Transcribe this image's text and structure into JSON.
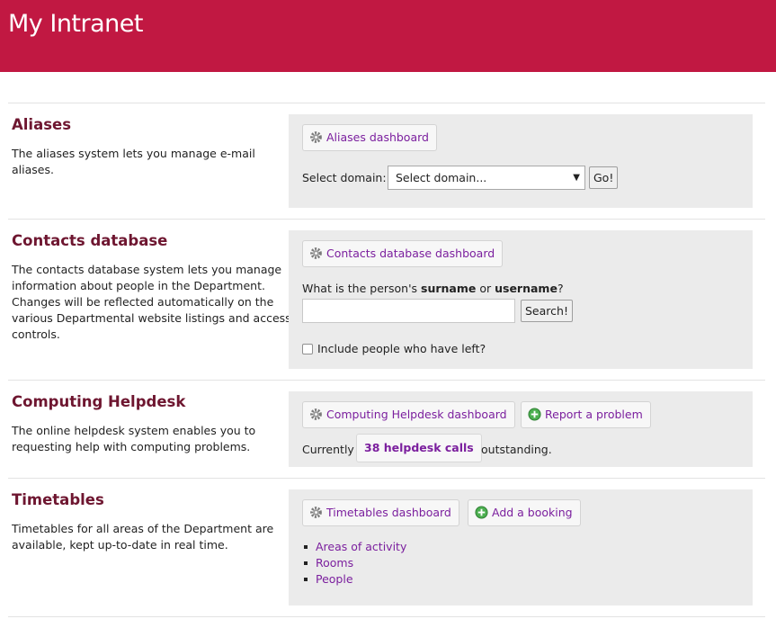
{
  "header": {
    "title": "My Intranet"
  },
  "aliases": {
    "title": "Aliases",
    "description_lines": [
      "The aliases system lets you manage e-mail",
      "aliases."
    ],
    "dashboard_label": "Aliases dashboard",
    "select_label": "Select domain:",
    "select_value": "Select domain...",
    "go_label": "Go!"
  },
  "contacts": {
    "title": "Contacts database",
    "description_lines": [
      "The contacts database system lets you manage",
      "information about people in the Department.",
      "Changes will be reflected automatically on the",
      "various Departmental website listings and access",
      "controls."
    ],
    "dashboard_label": "Contacts database dashboard",
    "question_prefix": "What is the person's ",
    "question_bold1": "surname",
    "question_mid": " or ",
    "question_bold2": "username",
    "question_suffix": "?",
    "search_value": "",
    "search_label": "Search!",
    "include_left_label": "Include people who have left?",
    "include_left_checked": false
  },
  "helpdesk": {
    "title": "Computing Helpdesk",
    "description_lines": [
      "The online helpdesk system enables you to",
      "requesting help with computing problems."
    ],
    "dashboard_label": "Computing Helpdesk dashboard",
    "report_label": "Report a problem",
    "currently_label": "Currently",
    "calls_label": "38 helpdesk calls",
    "outstanding_label": "outstanding."
  },
  "timetables": {
    "title": "Timetables",
    "description_lines": [
      "Timetables for all areas of the Department are",
      "available, kept up-to-date in real time."
    ],
    "dashboard_label": "Timetables dashboard",
    "add_booking_label": "Add a booking",
    "links": [
      "Areas of activity",
      "Rooms",
      "People"
    ]
  },
  "colors": {
    "brand": "#c11842",
    "heading": "#6e1630",
    "link": "#7b1f9e",
    "panel": "#ebebeb"
  },
  "icons": {
    "dashboard": "gear-icon",
    "add": "plus-circle-icon"
  }
}
